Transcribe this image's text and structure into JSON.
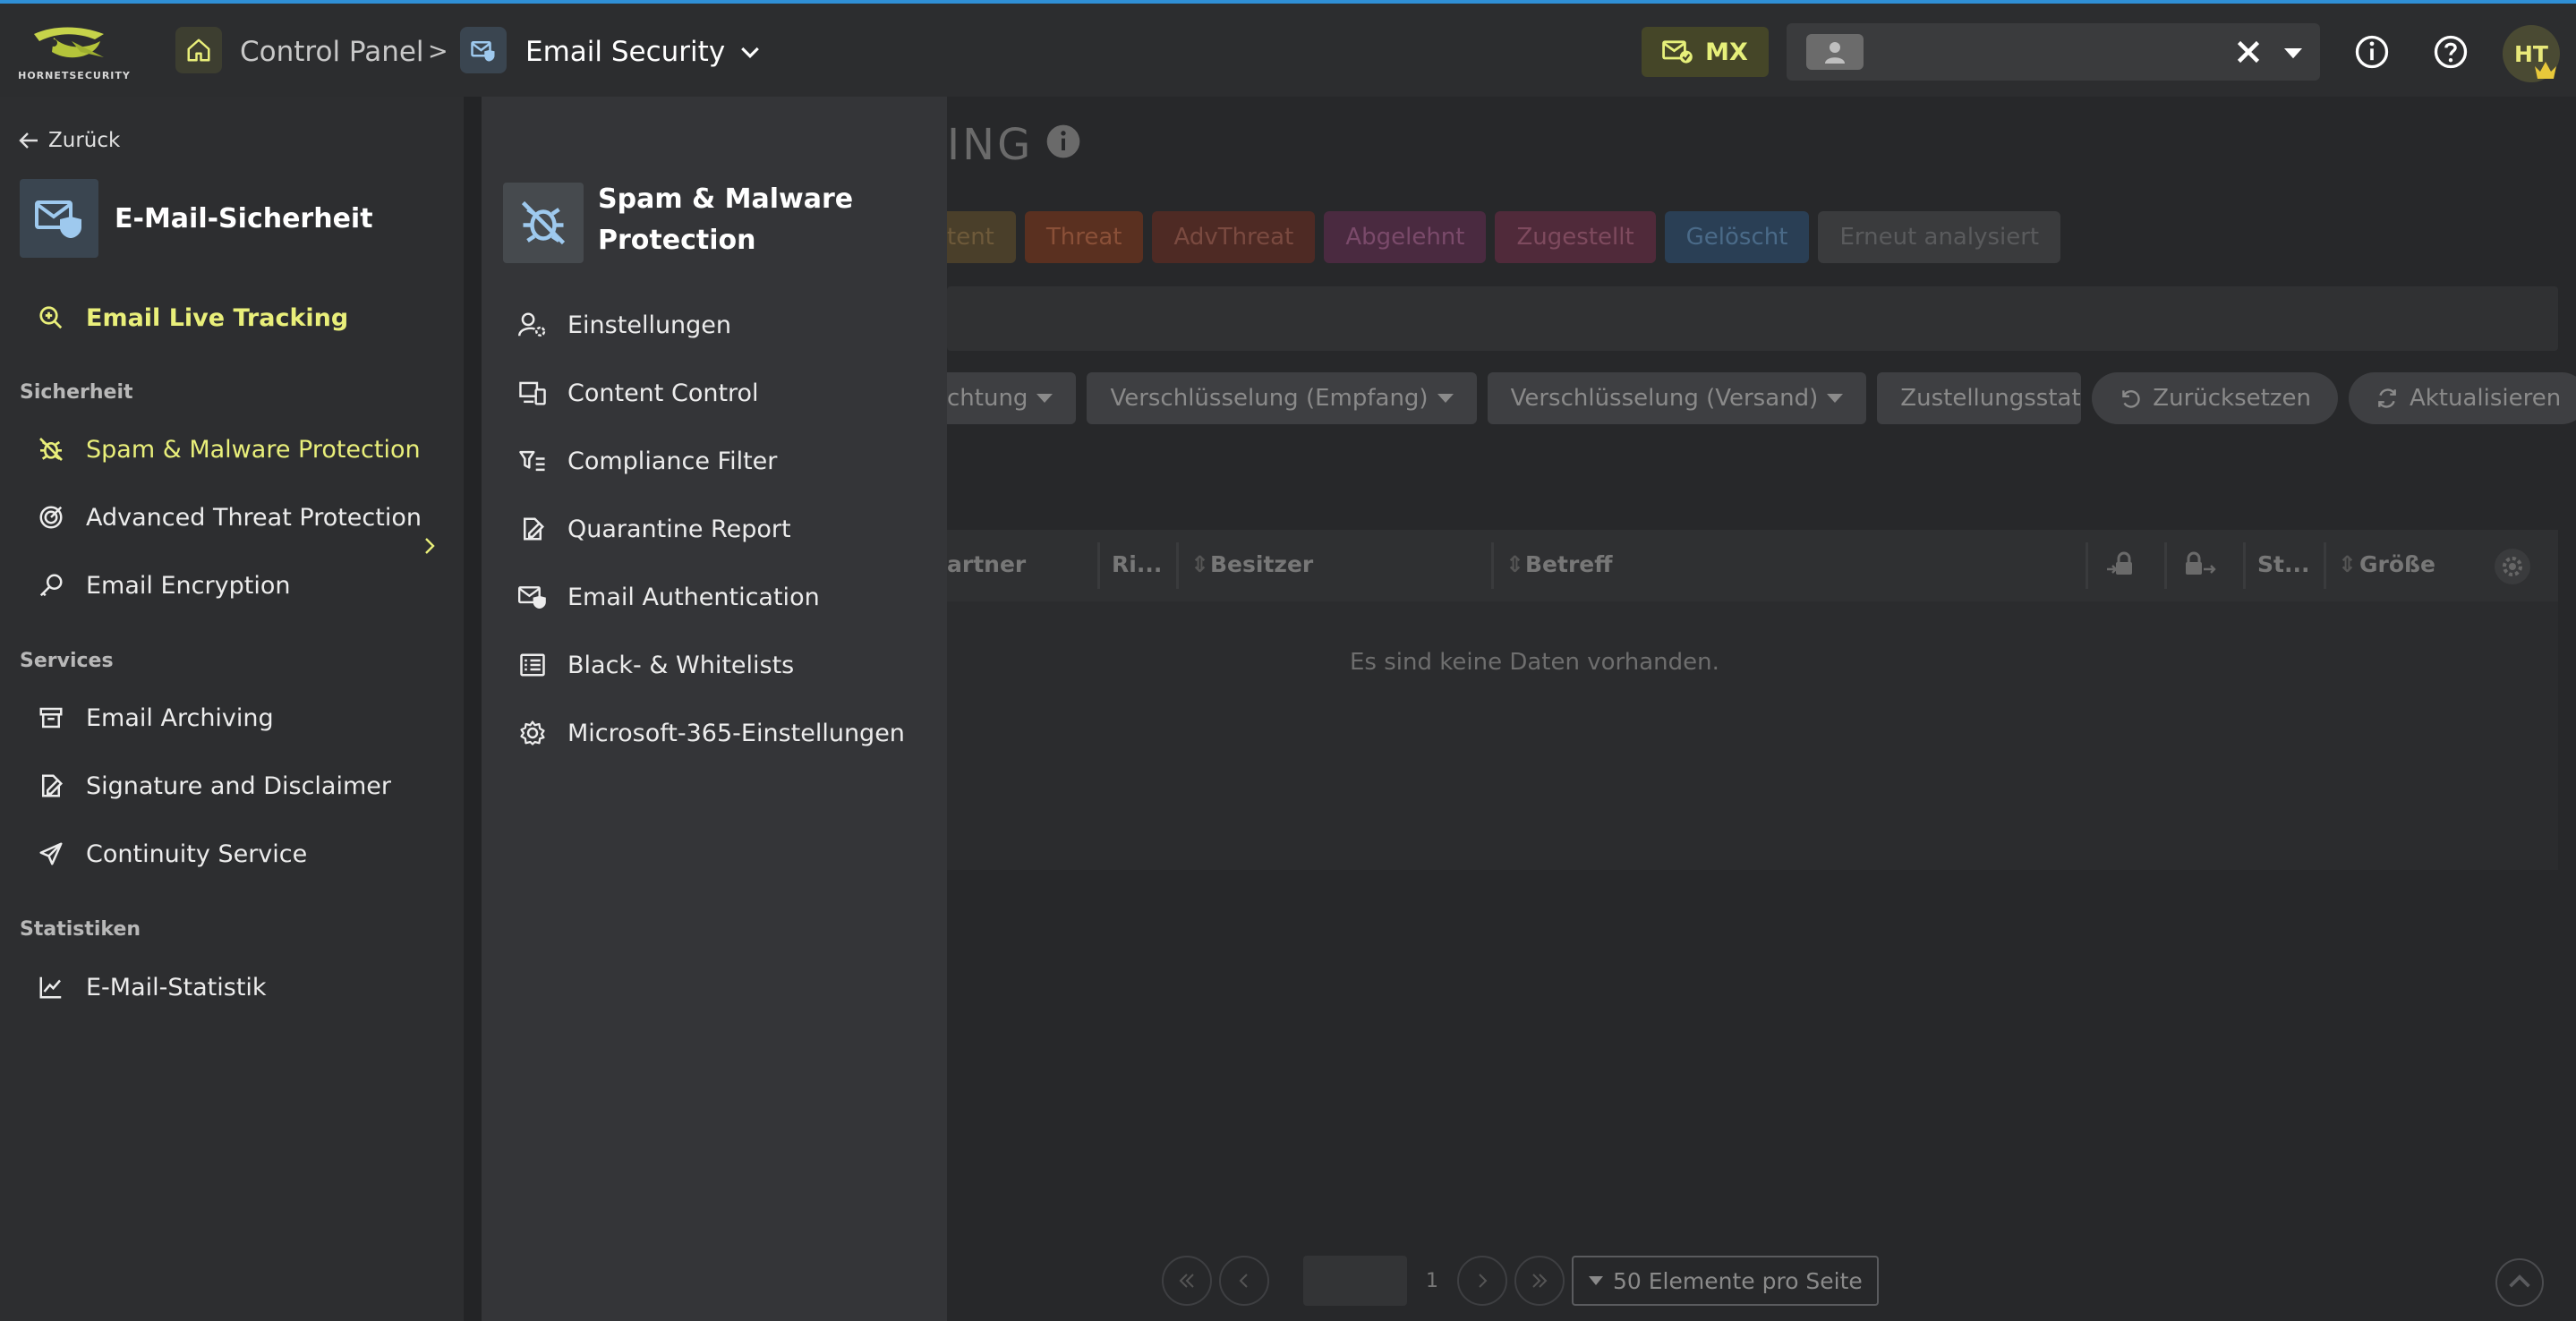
{
  "header": {
    "logo_text": "HORNETSECURITY",
    "breadcrumb": {
      "control_panel": "Control Panel",
      "separator": ">",
      "email_security": "Email Security"
    },
    "mx_label": "MX",
    "search": {
      "value": "",
      "placeholder": ""
    },
    "avatar_initials": "HT",
    "accent_color": "#e9ef7a"
  },
  "sidebar": {
    "back_label": "Zurück",
    "section_title": "E-Mail-Sicherheit",
    "live_tracking": "Email Live Tracking",
    "groups": [
      {
        "label": "Sicherheit",
        "items": [
          "Spam & Malware Protection",
          "Advanced Threat Protection",
          "Email Encryption"
        ]
      },
      {
        "label": "Services",
        "items": [
          "Email Archiving",
          "Signature and Disclaimer",
          "Continuity Service"
        ]
      },
      {
        "label": "Statistiken",
        "items": [
          "E-Mail-Statistik"
        ]
      }
    ]
  },
  "submenu": {
    "title": "Spam & Malware Protection",
    "items": [
      "Einstellungen",
      "Content Control",
      "Compliance Filter",
      "Quarantine Report",
      "Email Authentication",
      "Black- & Whitelists",
      "Microsoft-365-Einstellungen"
    ]
  },
  "main": {
    "title_partial": "ING",
    "tags": [
      {
        "label": "tent",
        "bg": "#4a3f2a",
        "fg": "#6e5a3a"
      },
      {
        "label": "Threat",
        "bg": "#5a3020",
        "fg": "#8a5038"
      },
      {
        "label": "AdvThreat",
        "bg": "#4e2a24",
        "fg": "#7a4a40"
      },
      {
        "label": "Abgelehnt",
        "bg": "#4a2a40",
        "fg": "#7a4a6a"
      },
      {
        "label": "Zugestellt",
        "bg": "#502a3a",
        "fg": "#7e4a5e"
      },
      {
        "label": "Gelöscht",
        "bg": "#2a3f55",
        "fg": "#4a6a88"
      },
      {
        "label": "Erneut analysiert",
        "bg": "#3a3b3d",
        "fg": "#5a5b5d"
      }
    ],
    "filters": [
      "chtung",
      "Verschlüsselung (Empfang)",
      "Verschlüsselung (Versand)",
      "Zustellungsstat"
    ],
    "reset_label": "Zurücksetzen",
    "refresh_label": "Aktualisieren",
    "columns": [
      "artner",
      "Ri...",
      "Besitzer",
      "Betreff",
      "St...",
      "Größe"
    ],
    "no_data": "Es sind keine Daten vorhanden.",
    "pager": {
      "page": "1",
      "per_page": "50 Elemente pro Seite"
    }
  }
}
